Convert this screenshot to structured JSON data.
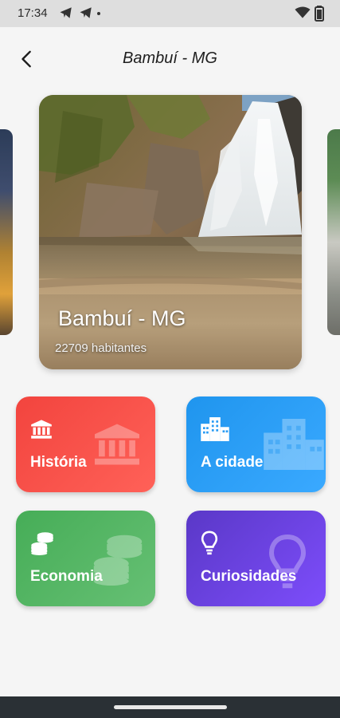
{
  "status_bar": {
    "time": "17:34",
    "icons": [
      "telegram-icon",
      "telegram-icon",
      "wifi-icon",
      "battery-icon"
    ]
  },
  "app_bar": {
    "title": "Bambuí - MG",
    "back_icon": "arrow-back-icon"
  },
  "carousel": {
    "current": {
      "title": "Bambuí - MG",
      "subtitle": "22709 habitantes"
    }
  },
  "tiles": [
    {
      "label": "História",
      "icon": "bank-icon",
      "color": "#f4473f"
    },
    {
      "label": "A cidade",
      "icon": "city-icon",
      "color": "#2a9cf4"
    },
    {
      "label": "Economia",
      "icon": "coins-icon",
      "color": "#4caf50"
    },
    {
      "label": "Curiosidades",
      "icon": "lightbulb-icon",
      "color": "#6a41e0"
    }
  ]
}
